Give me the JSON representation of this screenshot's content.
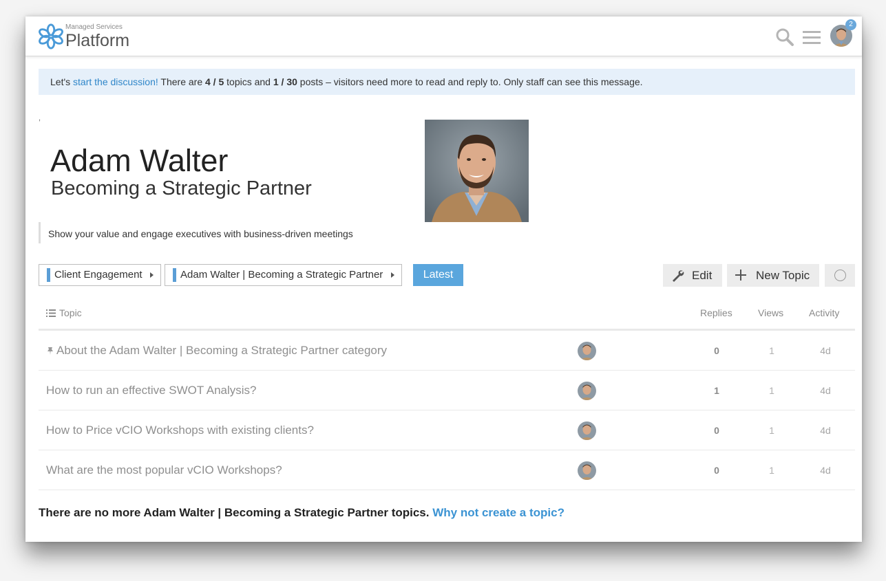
{
  "header": {
    "logo_subtitle": "Managed Services",
    "logo_title": "Platform",
    "notification_count": "2"
  },
  "notice": {
    "prefix": "Let's ",
    "link_text": "start the discussion!",
    "text1": " There are ",
    "topics_count": "4 / 5",
    "text2": " topics and ",
    "posts_count": "1 / 30",
    "text3": " posts – visitors need more to read and reply to. Only staff can see this message."
  },
  "category": {
    "tick": ",",
    "title": "Adam Walter",
    "subtitle": "Becoming a Strategic Partner",
    "description": "Show your value and engage executives with business-driven meetings"
  },
  "nav": {
    "breadcrumbs": [
      {
        "label": "Client Engagement",
        "color": "#5b9ed6"
      },
      {
        "label": "Adam Walter | Becoming a Strategic Partner",
        "color": "#5b9ed6"
      }
    ],
    "latest_label": "Latest",
    "edit_label": "Edit",
    "new_topic_label": "New Topic"
  },
  "table": {
    "headers": {
      "topic": "Topic",
      "replies": "Replies",
      "views": "Views",
      "activity": "Activity"
    },
    "rows": [
      {
        "title": "About the Adam Walter | Becoming a Strategic Partner category",
        "pinned": true,
        "replies": "0",
        "views": "1",
        "activity": "4d"
      },
      {
        "title": "How to run an effective SWOT Analysis?",
        "pinned": false,
        "replies": "1",
        "views": "1",
        "activity": "4d"
      },
      {
        "title": "How to Price vCIO Workshops with existing clients?",
        "pinned": false,
        "replies": "0",
        "views": "1",
        "activity": "4d"
      },
      {
        "title": "What are the most popular vCIO Workshops?",
        "pinned": false,
        "replies": "0",
        "views": "1",
        "activity": "4d"
      }
    ]
  },
  "footer": {
    "text": "There are no more Adam Walter | Becoming a Strategic Partner topics. ",
    "link_text": "Why not create a topic?"
  },
  "colors": {
    "accent": "#5aa6dd",
    "link": "#2f86c9",
    "notice_bg": "#e6f0fa"
  }
}
